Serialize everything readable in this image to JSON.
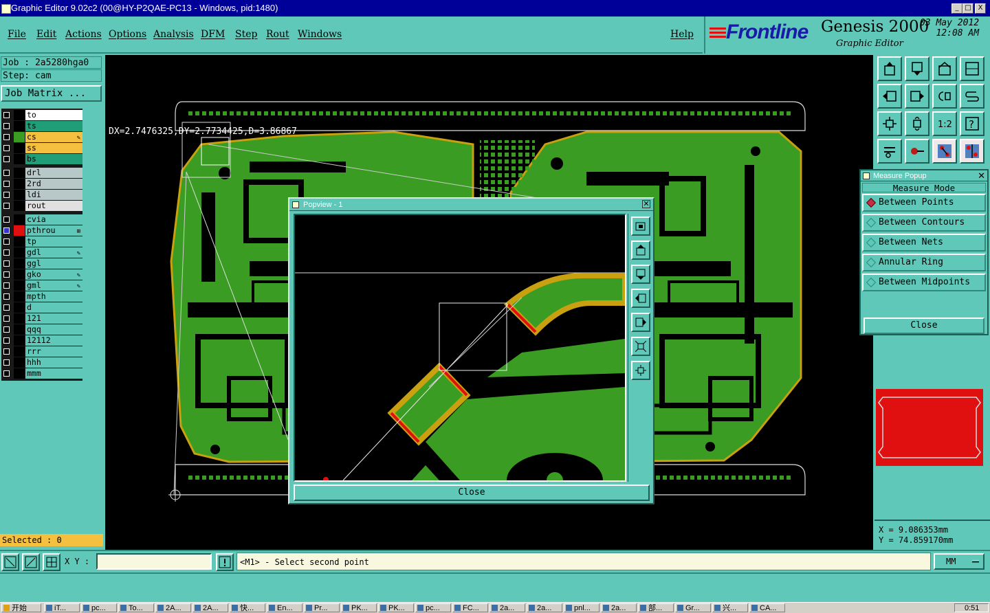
{
  "window": {
    "title": "Graphic Editor 9.02c2 (00@HY-P2QAE-PC13 - Windows, pid:1480)",
    "controls": [
      "_",
      "□",
      "X"
    ]
  },
  "menu": {
    "items": [
      "File",
      "Edit",
      "Actions",
      "Options",
      "Analysis",
      "DFM",
      "Step",
      "Rout",
      "Windows"
    ],
    "help": "Help"
  },
  "brand": {
    "logo": "Frontline",
    "product": "Genesis 2000",
    "subtitle": "Graphic Editor",
    "date": "03 May 2012",
    "time": "12:08 AM"
  },
  "job": {
    "job_label": "Job : 2a5280hga0",
    "step_label": "Step: cam",
    "matrix_button": "Job Matrix ..."
  },
  "layers": {
    "group1": [
      {
        "name": "to",
        "color": "#ffffff",
        "swatch": "#000000",
        "flag": ""
      },
      {
        "name": "ts",
        "color": "#1f9e78",
        "swatch": "#000000",
        "flag": ""
      },
      {
        "name": "cs",
        "color": "#f5c040",
        "swatch": "#3a9c22",
        "flag": "✎"
      },
      {
        "name": "ss",
        "color": "#f5c040",
        "swatch": "#000000",
        "flag": ""
      },
      {
        "name": "bs",
        "color": "#1f9e78",
        "swatch": "#000000",
        "flag": ""
      }
    ],
    "group2": [
      {
        "name": "drl",
        "color": "#b8c8c8",
        "swatch": "#000000",
        "flag": ""
      },
      {
        "name": "2rd",
        "color": "#b8c8c8",
        "swatch": "#000000",
        "flag": ""
      },
      {
        "name": "ldi",
        "color": "#b8c8c8",
        "swatch": "#000000",
        "flag": ""
      },
      {
        "name": "rout",
        "color": "#e0e0e0",
        "swatch": "#000000",
        "flag": ""
      }
    ],
    "group3": [
      {
        "name": "cvia",
        "color": "#5fc8b8",
        "swatch": "#000000",
        "flag": ""
      },
      {
        "name": "pthrou",
        "color": "#5fc8b8",
        "swatch": "#e01010",
        "flag": "⊞",
        "checked": true
      },
      {
        "name": "tp",
        "color": "#5fc8b8",
        "swatch": "#000000",
        "flag": ""
      },
      {
        "name": "gdl",
        "color": "#5fc8b8",
        "swatch": "#000000",
        "flag": "✎"
      },
      {
        "name": "ggl",
        "color": "#5fc8b8",
        "swatch": "#000000",
        "flag": ""
      },
      {
        "name": "gko",
        "color": "#5fc8b8",
        "swatch": "#000000",
        "flag": "✎"
      },
      {
        "name": "gml",
        "color": "#5fc8b8",
        "swatch": "#000000",
        "flag": "✎"
      },
      {
        "name": "mpth",
        "color": "#5fc8b8",
        "swatch": "#000000",
        "flag": ""
      },
      {
        "name": "d",
        "color": "#5fc8b8",
        "swatch": "#000000",
        "flag": ""
      },
      {
        "name": "121",
        "color": "#5fc8b8",
        "swatch": "#000000",
        "flag": ""
      },
      {
        "name": "qqq",
        "color": "#5fc8b8",
        "swatch": "#000000",
        "flag": ""
      },
      {
        "name": "12112",
        "color": "#5fc8b8",
        "swatch": "#000000",
        "flag": ""
      },
      {
        "name": "rrr",
        "color": "#5fc8b8",
        "swatch": "#000000",
        "flag": ""
      },
      {
        "name": "hhh",
        "color": "#5fc8b8",
        "swatch": "#000000",
        "flag": ""
      },
      {
        "name": "mmm",
        "color": "#5fc8b8",
        "swatch": "#000000",
        "flag": ""
      }
    ]
  },
  "selected": "Selected : 0",
  "canvas": {
    "readout": "DX=2.7476325,DY=2.7734425,D=3.86867"
  },
  "popview": {
    "title": "Popview - 1",
    "close": "Close"
  },
  "measure": {
    "title": "Measure Popup",
    "header": "Measure Mode",
    "modes": [
      {
        "label": "Between Points",
        "active": true
      },
      {
        "label": "Between Contours",
        "active": false
      },
      {
        "label": "Between Nets",
        "active": false
      },
      {
        "label": "Annular Ring",
        "active": false
      },
      {
        "label": "Between Midpoints",
        "active": false
      }
    ],
    "close": "Close"
  },
  "coords": {
    "x": "X = 9.086353mm",
    "y": "Y = 74.859170mm"
  },
  "status": {
    "xy_label": "X Y :",
    "xy_value": "",
    "prompt": "<M1> - Select second point",
    "units": "MM"
  },
  "taskbar": {
    "start": "开始",
    "tasks": [
      "iT...",
      "pc...",
      "To...",
      "2A...",
      "2A...",
      "快...",
      "En...",
      "Pr...",
      "PK...",
      "PK...",
      "pc...",
      "FC...",
      "2a...",
      "2a...",
      "pnl...",
      "2a...",
      "部...",
      "Gr...",
      "兴...",
      "CA..."
    ],
    "clock": "0:51"
  },
  "colors": {
    "panel": "#5fc8b8",
    "copper": "#3a9c22",
    "mask": "#c8a010",
    "highlight": "#e01010"
  }
}
